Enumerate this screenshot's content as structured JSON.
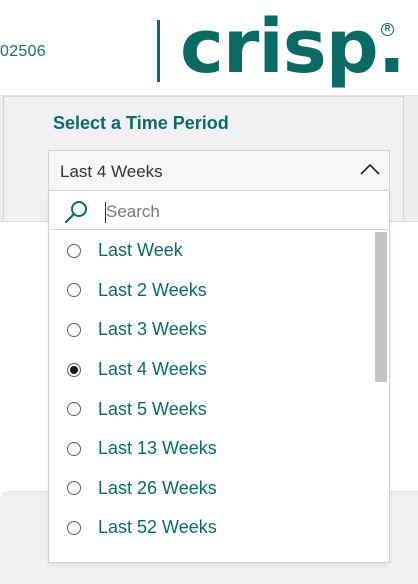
{
  "header": {
    "id_text": "02506",
    "logo_text": "crisp.",
    "logo_registered": "R"
  },
  "filter": {
    "title": "Select a Time Period",
    "selected_value": "Last 4 Weeks",
    "chevron_icon": "chevron-up-icon"
  },
  "dropdown": {
    "search_placeholder": "Search",
    "search_icon": "search-icon",
    "options": [
      {
        "label": "Last Week",
        "selected": false
      },
      {
        "label": "Last 2 Weeks",
        "selected": false
      },
      {
        "label": "Last 3 Weeks",
        "selected": false
      },
      {
        "label": "Last 4 Weeks",
        "selected": true
      },
      {
        "label": "Last 5 Weeks",
        "selected": false
      },
      {
        "label": "Last 13 Weeks",
        "selected": false
      },
      {
        "label": "Last 26 Weeks",
        "selected": false
      },
      {
        "label": "Last 52 Weeks",
        "selected": false
      }
    ]
  },
  "colors": {
    "brand": "#0c6a63",
    "option_text": "#0c6a63",
    "background": "#f4f5f6",
    "scrollbar_thumb": "#c4c4c4"
  }
}
